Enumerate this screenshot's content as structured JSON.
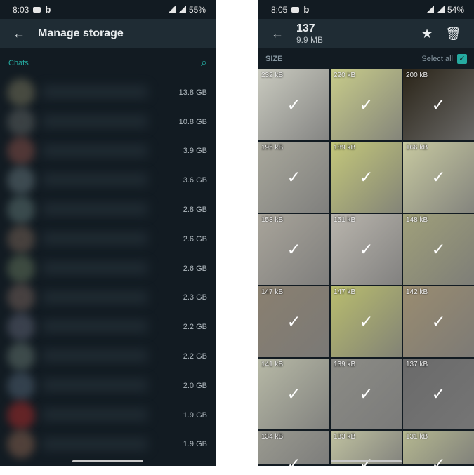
{
  "left": {
    "status": {
      "time": "8:03",
      "battery": "55%"
    },
    "title": "Manage storage",
    "section": "Chats",
    "avatar_colors": [
      "#6b6a55",
      "#555a5a",
      "#7a4a44",
      "#5a6a70",
      "#556a6a",
      "#6a5a50",
      "#5a6a55",
      "#6a5a55",
      "#555a6a",
      "#5a6a66",
      "#4a5a6a",
      "#9a2a2a",
      "#7a5a4a"
    ],
    "sizes": [
      "13.8 GB",
      "10.8 GB",
      "3.9 GB",
      "3.6 GB",
      "2.8 GB",
      "2.6 GB",
      "2.6 GB",
      "2.3 GB",
      "2.2 GB",
      "2.2 GB",
      "2.0 GB",
      "1.9 GB",
      "1.9 GB"
    ]
  },
  "right": {
    "status": {
      "time": "8:05",
      "battery": "54%"
    },
    "count": "137",
    "total": "9.9 MB",
    "size_label": "SIZE",
    "select_all": "Select all",
    "items": [
      "232 kB",
      "220 kB",
      "200 kB",
      "195 kB",
      "189 kB",
      "166 kB",
      "153 kB",
      "151 kB",
      "148 kB",
      "147 kB",
      "147 kB",
      "142 kB",
      "141 kB",
      "139 kB",
      "137 kB",
      "134 kB",
      "133 kB",
      "131 kB"
    ],
    "thumb_colors": [
      "#c9cabf",
      "#c8cc8a",
      "#2a2418",
      "#a9a89c",
      "#c4c87a",
      "#c7c9a0",
      "#a8a49a",
      "#b9b5ad",
      "#a0a07a",
      "#8a8070",
      "#b9bd6e",
      "#9a8c70",
      "#b7b9a6",
      "#8c8c86",
      "#6a6a6a",
      "#9a9a90",
      "#c0c2a0",
      "#b5b890"
    ],
    "check": "✓",
    "accent": "#25aaa0"
  }
}
